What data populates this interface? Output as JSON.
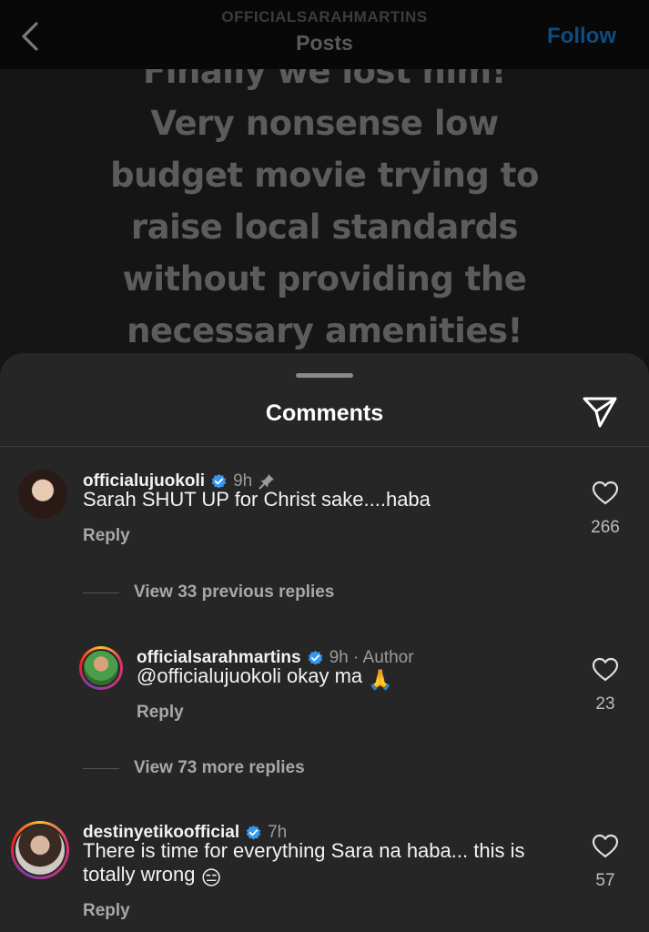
{
  "header": {
    "account": "OFFICIALSARAHMARTINS",
    "title": "Posts",
    "follow_label": "Follow"
  },
  "post": {
    "lines": [
      "Finally we lost him!",
      "Very nonsense low",
      "budget movie trying to",
      "raise local standards",
      "without providing the",
      "necessary amenities!"
    ]
  },
  "comments_sheet": {
    "title": "Comments",
    "icons": {
      "share": "paper-plane-icon",
      "back": "chevron-left-icon"
    },
    "comments": [
      {
        "username": "officialujuokoli",
        "verified": true,
        "time": "9h",
        "pinned": true,
        "text": "Sarah SHUT UP for Christ sake....haba",
        "reply_label": "Reply",
        "likes": "266"
      },
      {
        "username": "officialsarahmartins",
        "verified": true,
        "time": "9h · Author",
        "text": "@officialujuokoli okay ma",
        "emoji": "🙏",
        "reply_label": "Reply",
        "likes": "23"
      },
      {
        "username": "destinyetikoofficial",
        "verified": true,
        "time": "7h",
        "text": "There is time for everything Sara na haba... this is totally wrong",
        "emoji": "😑",
        "reply_label": "Reply",
        "likes": "57"
      }
    ],
    "view_previous": "View 33 previous replies",
    "view_more": "View 73 more replies"
  },
  "colors": {
    "verified_blue": "#3897f0",
    "follow_blue": "#0c4d82",
    "sheet_bg": "#262626"
  }
}
